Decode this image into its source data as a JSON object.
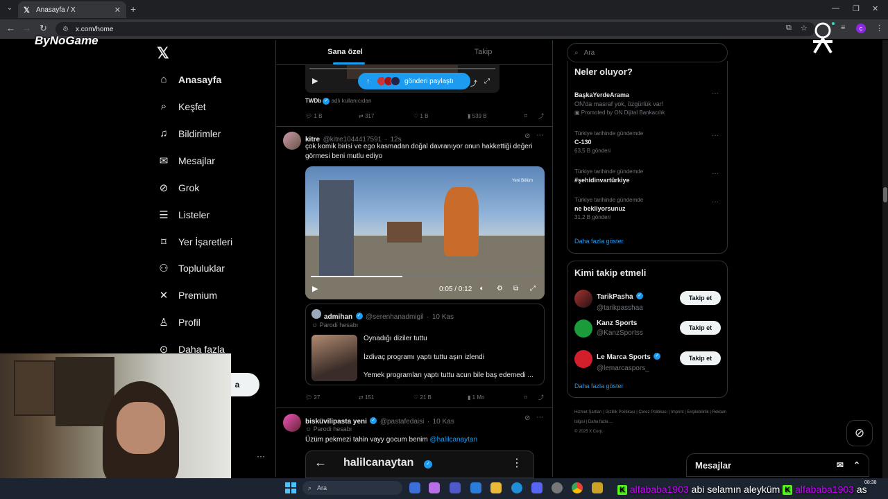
{
  "browser": {
    "tab_title": "Anasayfa / X",
    "url": "x.com/home",
    "profile_initial": "c"
  },
  "overlay": {
    "brand": "ByNoGame"
  },
  "sidebar": {
    "items": [
      {
        "label": "Anasayfa",
        "icon": "home-icon"
      },
      {
        "label": "Keşfet",
        "icon": "search-icon"
      },
      {
        "label": "Bildirimler",
        "icon": "bell-icon"
      },
      {
        "label": "Mesajlar",
        "icon": "mail-icon"
      },
      {
        "label": "Grok",
        "icon": "grok-icon"
      },
      {
        "label": "Listeler",
        "icon": "list-icon"
      },
      {
        "label": "Yer İşaretleri",
        "icon": "bookmark-icon"
      },
      {
        "label": "Topluluklar",
        "icon": "people-icon"
      },
      {
        "label": "Premium",
        "icon": "x-icon"
      },
      {
        "label": "Profil",
        "icon": "user-icon"
      },
      {
        "label": "Daha fazla",
        "icon": "more-icon"
      }
    ],
    "post_label": "a"
  },
  "timeline": {
    "tabs": [
      "Sana özel",
      "Takip"
    ],
    "share_label": "gönderi paylaştı",
    "post0": {
      "source": "TWDb",
      "source_suffix": "adlı kullanıcıdan",
      "replies": "1 B",
      "reposts": "317",
      "likes": "1 B",
      "views": "539 B"
    },
    "post1": {
      "name": "kitre",
      "handle": "@kitre1044417591",
      "time": "12s",
      "text": "çok komik birisi ve ego kasmadan doğal davranıyor onun hakkettiği değeri görmesi beni mutlu ediyo",
      "video_time": "0:05 / 0:12",
      "watermark": "Yeni Bölüm",
      "quote": {
        "name": "admihan",
        "handle": "@serenhanadmigil",
        "time": "10 Kas",
        "label": "Parodi hesabı",
        "line1": "Oynadığı diziler tuttu",
        "line2": "İzdivaç programı yaptı tuttu aşırı izlendi",
        "line3": "Yemek programları yaptı tuttu acun bile baş edemedi ..."
      },
      "replies": "27",
      "reposts": "151",
      "likes": "21 B",
      "views": "1 Mn"
    },
    "post2": {
      "name": "bisküvilipasta yeni",
      "handle": "@pastafedaisi",
      "time": "10 Kas",
      "label": "Parodi hesabı",
      "text": "Üzüm pekmezi tahin vayy gocum benim",
      "mention": "@halilcanaytan",
      "embedded_name": "halilcanaytan"
    }
  },
  "right": {
    "search_placeholder": "Ara",
    "trends_title": "Neler oluyor?",
    "trends": [
      {
        "title": "BaşkaYerdeArama",
        "sub": "ON'da masraf yok, özgürlük var!",
        "meta": "Promoted by ON Dijital Bankacılık"
      },
      {
        "context": "Türkiye tarihinde gündemde",
        "title": "C-130",
        "meta": "63,5 B gönderi"
      },
      {
        "context": "Türkiye tarihinde gündemde",
        "title": "#şehidinvartürkiye"
      },
      {
        "context": "Türkiye tarihinde gündemde",
        "title": "ne bekliyorsunuz",
        "meta": "31,2 B gönderi"
      }
    ],
    "show_more": "Daha fazla göster",
    "follow_title": "Kimi takip etmeli",
    "follow": [
      {
        "name": "TarikPasha",
        "handle": "@tarikpasshaa",
        "verified": true
      },
      {
        "name": "Kanz Sports",
        "handle": "@KanzSportss",
        "verified": false
      },
      {
        "name": "Le Marca Sports",
        "handle": "@lemarcaspors_",
        "verified": true
      }
    ],
    "follow_button": "Takip et",
    "footer": [
      "Hizmet Şartları",
      "Gizlilik Politikası",
      "Çerez Politikası",
      "Imprint",
      "Erişilebilirlik",
      "Reklam bilgisi",
      "Daha fazla ...",
      "© 2025 X Corp."
    ],
    "messages_label": "Mesajlar"
  },
  "taskbar": {
    "search_label": "Ara",
    "time": "08:38",
    "chat": [
      {
        "user": "alfababa1903",
        "message": "abi selamın aleyküm"
      },
      {
        "user": "alfababa1903",
        "message": "as"
      }
    ]
  }
}
